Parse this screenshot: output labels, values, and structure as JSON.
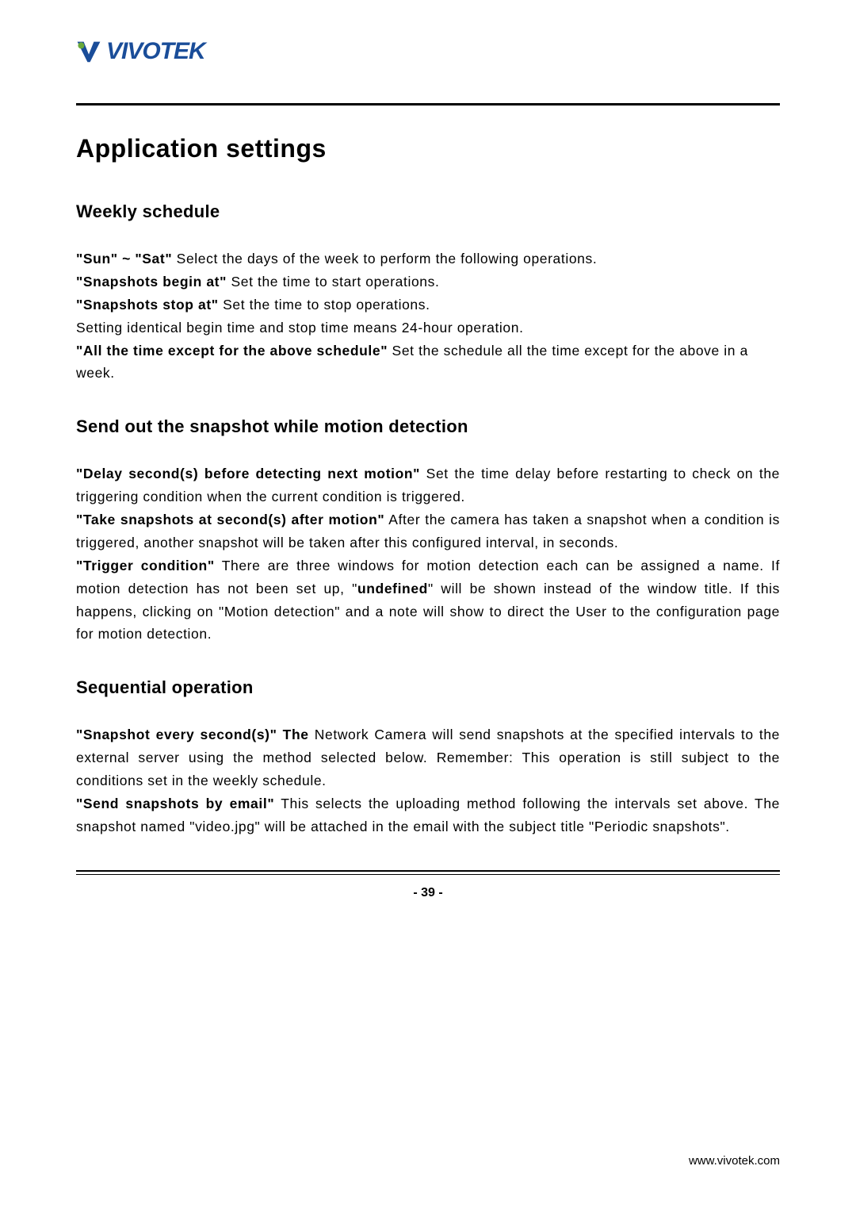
{
  "logo": {
    "text": "VIVOTEK"
  },
  "title": "Application settings",
  "sections": {
    "weekly": {
      "heading": "Weekly schedule",
      "para1_bold": "\"Sun\" ~ \"Sat\"",
      "para1_text": " Select the days of the week to perform the following operations.",
      "para2_bold": "\"Snapshots begin at\"",
      "para2_text": " Set the time to start operations.",
      "para3_bold": "\"Snapshots stop at\"",
      "para3_text": " Set the time to stop operations.",
      "para4_text": "Setting identical begin time and stop time means 24-hour operation.",
      "para5_bold": "\"All the time except for the above schedule\"",
      "para5_text": " Set the schedule all the time except for the above in a week."
    },
    "motion": {
      "heading": "Send out the snapshot while motion detection",
      "para1_bold": "\"Delay second(s) before detecting next motion\"",
      "para1_text": " Set the time delay before restarting to check on the triggering condition when the current condition is triggered.",
      "para2_bold": "\"Take snapshots at second(s) after motion\"",
      "para2_text": " After the camera has taken a snapshot when a condition is triggered, another snapshot will be taken after this configured interval, in seconds.",
      "para3_bold": "\"Trigger condition\"",
      "para3_text1": " There are three windows for motion detection each can be assigned a name. If motion detection has not been set up, \"",
      "para3_bold2": "undefined",
      "para3_text2": "\" will be shown instead of the window title. If this happens, clicking on \"Motion detection\" and a note will show to direct the User to the configuration page for motion detection."
    },
    "sequential": {
      "heading": "Sequential operation",
      "para1_bold": "\"Snapshot every second(s)\" The",
      "para1_text": " Network Camera will send snapshots at the specified intervals to the external server using the method selected below. Remember: This operation is still subject to the conditions set in the weekly schedule.",
      "para2_bold": "\"Send snapshots by email\"",
      "para2_text": " This selects the uploading method following the intervals set above. The snapshot named \"video.jpg\" will be attached in the email with the subject title \"Periodic snapshots\"."
    }
  },
  "page_number": "- 39 -",
  "footer_url": "www.vivotek.com"
}
